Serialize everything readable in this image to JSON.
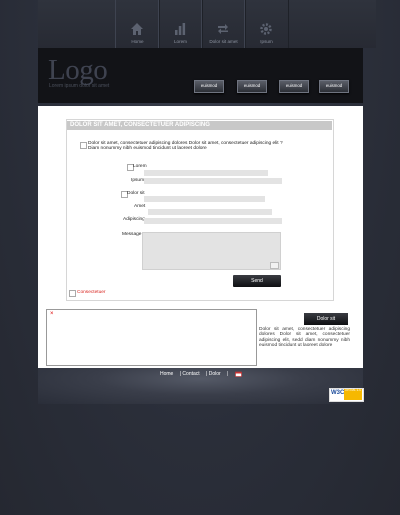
{
  "nav": [
    {
      "label": "Home",
      "icon": "home-icon"
    },
    {
      "label": "Lorem",
      "icon": "chart-icon"
    },
    {
      "label": "Dolor sit amet",
      "icon": "arrows-icon"
    },
    {
      "label": "Ipsum",
      "icon": "gear-icon"
    }
  ],
  "header": {
    "logo": "Logo",
    "tagline": "Lorem ipsum dolor sit amet",
    "buttons": [
      "euismod",
      "euismod",
      "euismod",
      "euismod"
    ]
  },
  "form": {
    "title": "Dolor sit amet, consectetuer adipiscing",
    "intro": "Dolor sit amet, consectetuer adipiscing dolores Dolor sit amet, consectetuer adipiscing elit ? Diam nonummy nibh euismod tincidunt ut laoreet dolore",
    "labels": {
      "lorem": "Lorem",
      "ipsum": "Ipsum",
      "dolor_sit": "Dolor sit",
      "amet": "Amet",
      "adipiscing": "Adipiscing",
      "message": "Message"
    },
    "send": "Send",
    "consectetuer": "Consectetuer"
  },
  "aside": {
    "button": "Dolor sit",
    "text": "Dolor sit amet, consectetuer adipiscing dolores Dolor sit amet, consectetuer adipiscing elit, sedd diam nonummy nibh euismod tincidunt ut laoreet dolore"
  },
  "footer": {
    "links": [
      "Home",
      "| Contact",
      "| Dolor",
      "|"
    ],
    "badge_w3c": "W3C",
    "badge_text": "XHTML 1.0"
  },
  "colors": {
    "background": "#2a2e39",
    "accent_red": "#d8241f",
    "header_bar": "#121317"
  }
}
